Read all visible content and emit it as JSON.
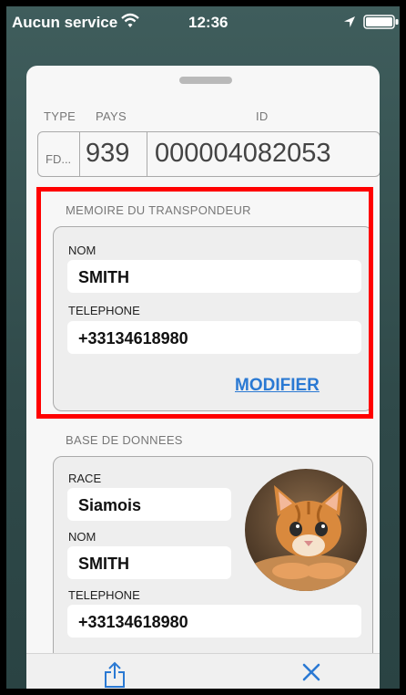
{
  "status_bar": {
    "carrier": "Aucun service",
    "time": "12:36",
    "icons": [
      "wifi-icon",
      "location-icon",
      "battery-icon"
    ]
  },
  "header": {
    "type_label": "TYPE",
    "pays_label": "PAYS",
    "id_label": "ID"
  },
  "transponder_id": {
    "type": "FD...",
    "pays": "939",
    "id": "000004082053"
  },
  "memory_section": {
    "title": "MEMOIRE DU TRANSPONDEUR",
    "name_label": "NOM",
    "name_value": "SMITH",
    "phone_label": "TELEPHONE",
    "phone_value": "+33134618980",
    "modify_label": "MODIFIER"
  },
  "database_section": {
    "title": "BASE DE DONNEES",
    "race_label": "RACE",
    "race_value": "Siamois",
    "name_label": "NOM",
    "name_value": "SMITH",
    "phone_label": "TELEPHONE",
    "phone_value": "+33134618980",
    "photo": "cat-photo"
  },
  "toolbar": {
    "icons": [
      "share-icon",
      "close-icon"
    ]
  },
  "colors": {
    "accent": "#2a79d3",
    "highlight": "#ff0000",
    "sheet_background": "#f7f7f7"
  }
}
